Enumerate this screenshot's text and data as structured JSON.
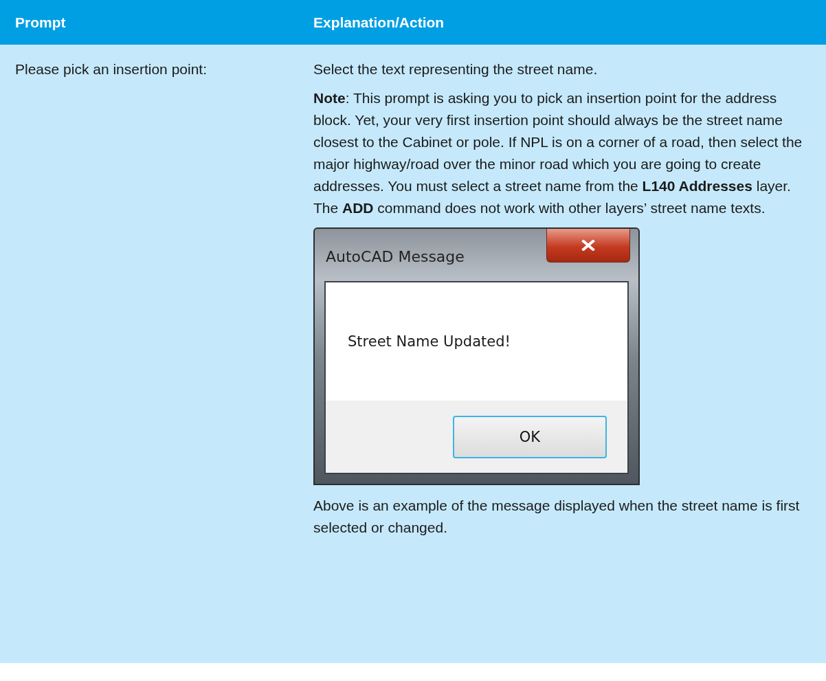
{
  "table": {
    "columns": [
      "Prompt",
      "Explanation/Action"
    ],
    "rows": [
      {
        "prompt": "Please pick an insertion point:",
        "explanation": [
          {
            "kind": "text",
            "text": "Select the text representing the street name."
          },
          {
            "kind": "text",
            "text": "**Note**: This prompt is asking you to pick an insertion point for the address block. Yet, your very first insertion point should always be the street name closest to the Cabinet or pole. If NPL is on a corner of a road, then select the major highway/road over the minor road which you are going to create addresses. You must select a street name from the **L140 Addresses** layer. The **ADD** command does not work with other layers’ street name texts."
          },
          {
            "kind": "dialog",
            "title": "AutoCAD Message",
            "message": "Street Name Updated!",
            "button": "OK"
          },
          {
            "kind": "text",
            "text": "Above is an example of the message displayed when the street name is first selected or changed."
          }
        ]
      }
    ]
  }
}
